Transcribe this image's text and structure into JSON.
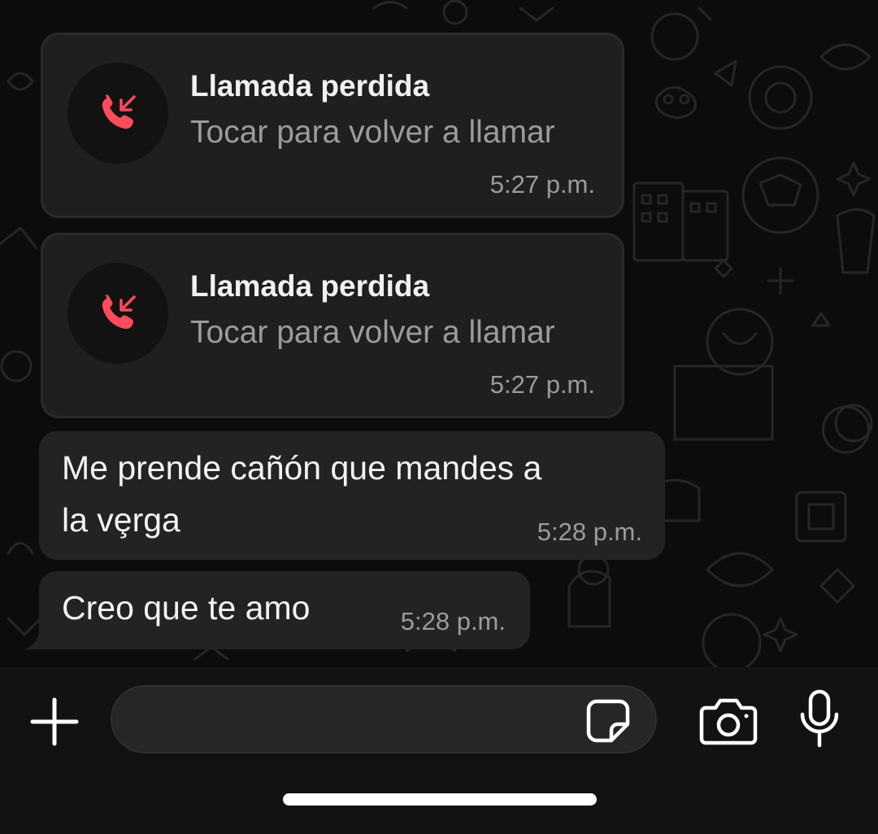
{
  "messages": {
    "call1": {
      "title": "Llamada perdida",
      "subtitle": "Tocar para volver a llamar",
      "time": "5:27 p.m."
    },
    "call2": {
      "title": "Llamada perdida",
      "subtitle": "Tocar para volver a llamar",
      "time": "5:27 p.m."
    },
    "msg1": {
      "line1": "Me prende cañón que mandes a",
      "line2": "la vȩrga",
      "time": "5:28 p.m."
    },
    "msg2": {
      "text": "Creo que te amo",
      "time": "5:28 p.m."
    }
  },
  "input": {
    "placeholder": "",
    "value": ""
  },
  "icons": {
    "missed_call": "missed-call-icon",
    "add": "plus-icon",
    "sticker": "sticker-icon",
    "camera": "camera-icon",
    "mic": "microphone-icon"
  },
  "colors": {
    "missed_call": "#ff4b5c",
    "bubble": "#1f1f1f",
    "background": "#0c0c0c"
  }
}
